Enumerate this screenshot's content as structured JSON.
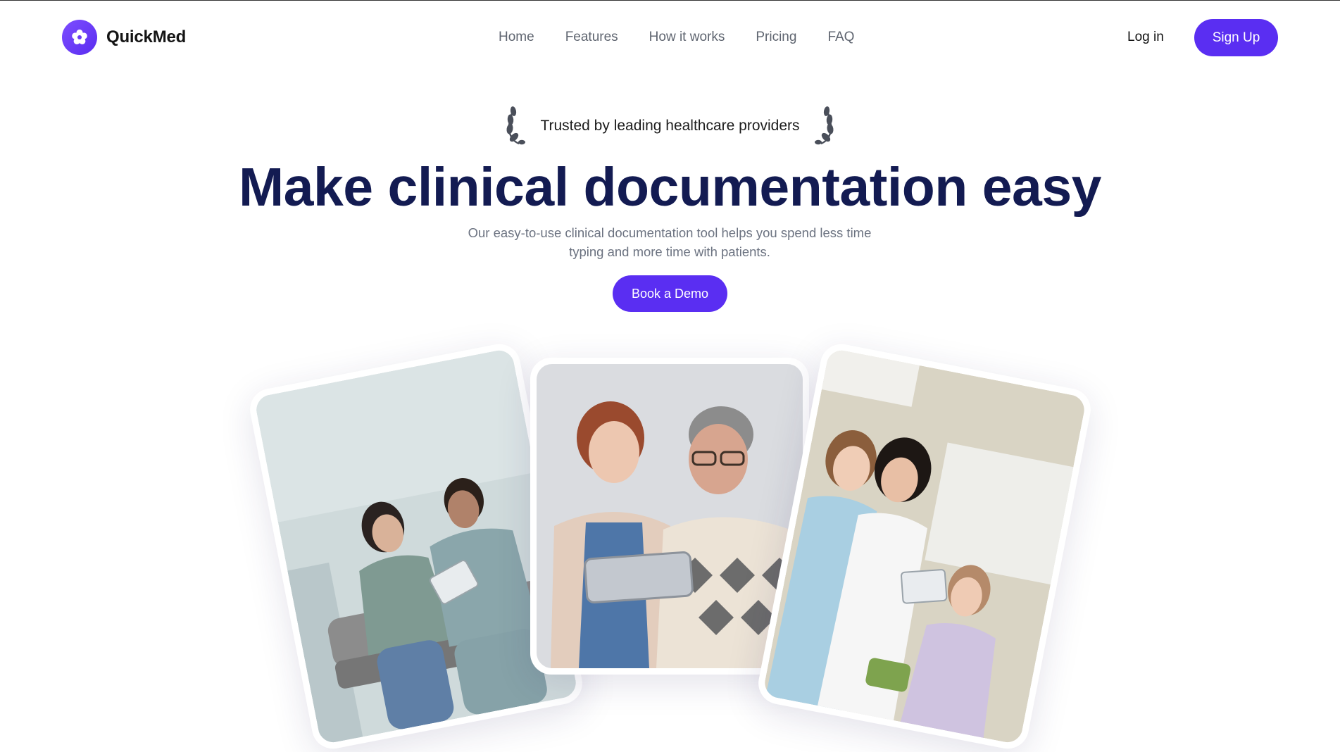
{
  "brand": {
    "name": "QuickMed",
    "logo_icon": "flower-icon"
  },
  "nav": {
    "items": [
      "Home",
      "Features",
      "How it works",
      "Pricing",
      "FAQ"
    ]
  },
  "auth": {
    "login_label": "Log in",
    "signup_label": "Sign Up"
  },
  "hero": {
    "trusted_text": "Trusted by leading healthcare providers",
    "headline": "Make clinical documentation easy",
    "subtext": "Our easy-to-use clinical documentation tool helps you spend less time typing and more time with patients.",
    "cta_label": "Book a Demo"
  },
  "colors": {
    "accent": "#5a2ef2",
    "headline": "#131b52",
    "muted": "#6b7280"
  }
}
